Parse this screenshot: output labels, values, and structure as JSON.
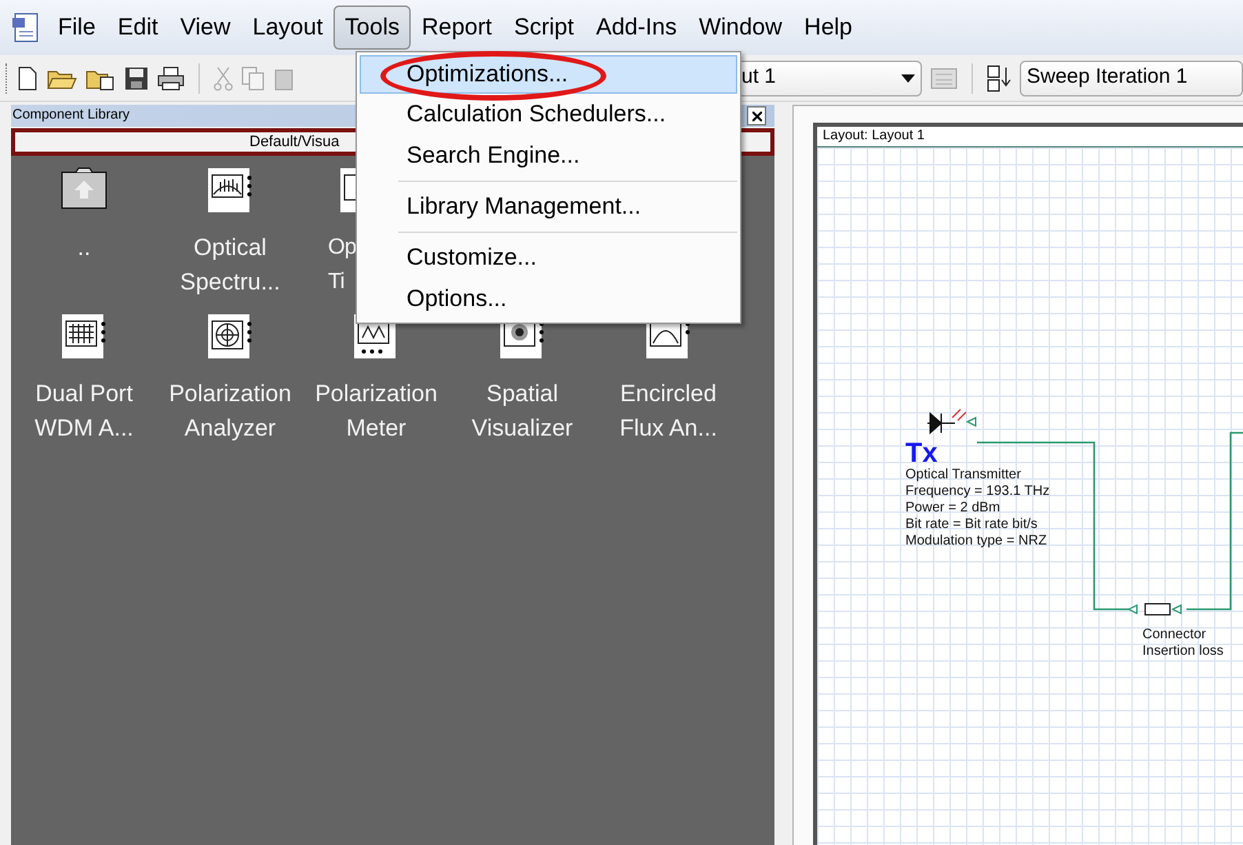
{
  "menu_bar": [
    {
      "label": "File",
      "selected": false
    },
    {
      "label": "Edit",
      "selected": false
    },
    {
      "label": "View",
      "selected": false
    },
    {
      "label": "Layout",
      "selected": false
    },
    {
      "label": "Tools",
      "selected": true
    },
    {
      "label": "Report",
      "selected": false
    },
    {
      "label": "Script",
      "selected": false
    },
    {
      "label": "Add-Ins",
      "selected": false
    },
    {
      "label": "Window",
      "selected": false
    },
    {
      "label": "Help",
      "selected": false
    }
  ],
  "toolbar": {
    "layout_combo": "ut 1",
    "sweep_combo": "Sweep Iteration 1"
  },
  "component_library": {
    "title": "Component Library",
    "path": "Default/Visua",
    "items": [
      {
        "kind": "folder",
        "lines": [
          ".."
        ]
      },
      {
        "kind": "spectrum",
        "lines": [
          "Optical",
          "Spectru..."
        ]
      },
      {
        "kind": "clipped",
        "lines": [
          "Op",
          "Ti"
        ]
      },
      {
        "kind": "empty"
      },
      {
        "kind": "empty"
      },
      {
        "kind": "wdm",
        "lines": [
          "Dual Port",
          "WDM A..."
        ]
      },
      {
        "kind": "polar",
        "lines": [
          "Polarization",
          "Analyzer"
        ]
      },
      {
        "kind": "meter",
        "lines": [
          "Polarization",
          "Meter"
        ]
      },
      {
        "kind": "spatial",
        "lines": [
          "Spatial",
          "Visualizer"
        ]
      },
      {
        "kind": "flux",
        "lines": [
          "Encircled",
          "Flux An..."
        ]
      }
    ]
  },
  "tools_menu": {
    "highlighted": true,
    "items": [
      {
        "label": "Optimizations...",
        "selected": true,
        "separator_before": false
      },
      {
        "label": "Calculation Schedulers...",
        "selected": false,
        "separator_before": false
      },
      {
        "label": "Search Engine...",
        "selected": false,
        "separator_before": false
      },
      {
        "label": "Library Management...",
        "selected": false,
        "separator_before": true
      },
      {
        "label": "Customize...",
        "selected": false,
        "separator_before": true
      },
      {
        "label": "Options...",
        "selected": false,
        "separator_before": false
      }
    ]
  },
  "layout_window": {
    "title": "Layout: Layout 1",
    "transmitter": {
      "symbol": "Tx",
      "lines": [
        "Optical Transmitter",
        "Frequency = 193.1  THz",
        "Power = 2  dBm",
        "Bit rate = Bit rate  bit/s",
        "Modulation type = NRZ"
      ]
    },
    "connector": {
      "lines": [
        "Connector",
        "Insertion loss"
      ]
    }
  }
}
